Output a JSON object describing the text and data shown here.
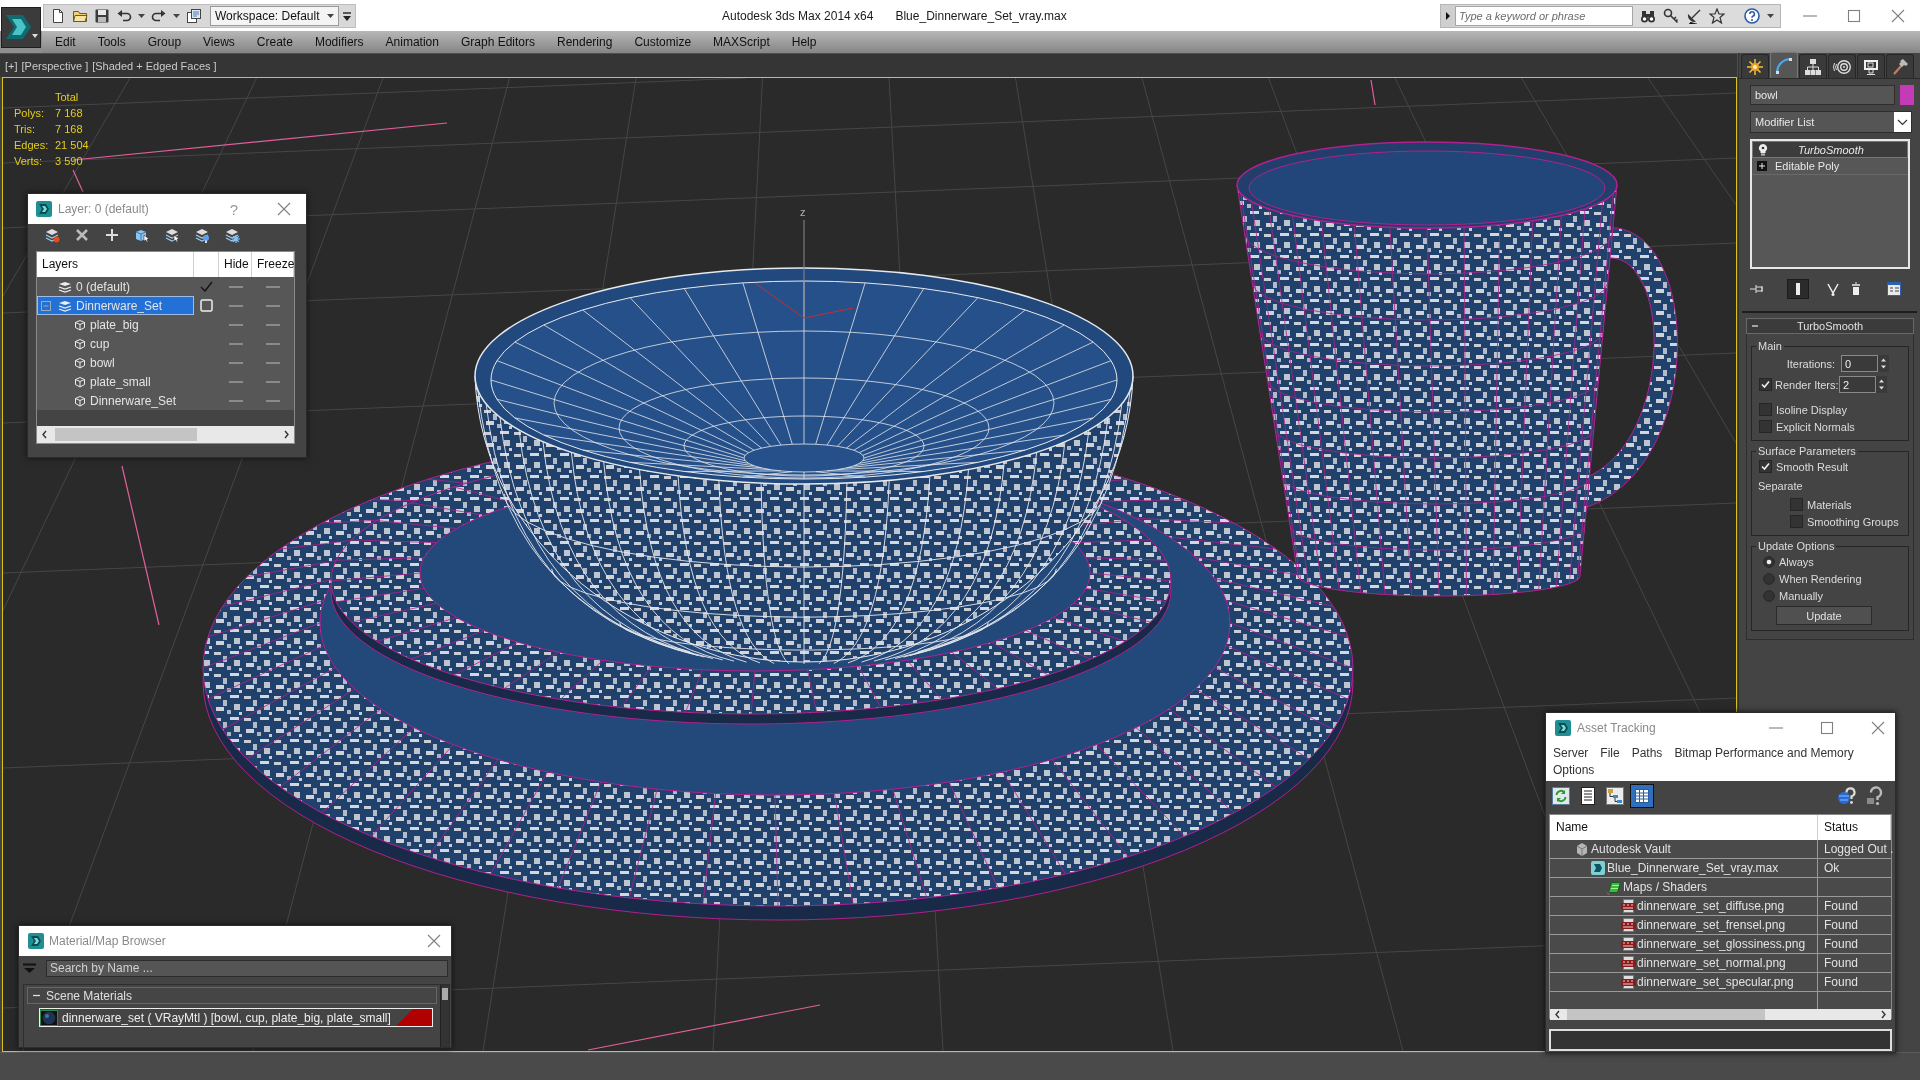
{
  "window": {
    "app_title": "Autodesk 3ds Max 2014 x64",
    "file_name": "Blue_Dinnerware_Set_vray.max",
    "workspace": "Workspace: Default",
    "search": {
      "placeholder": "Type a keyword or phrase"
    }
  },
  "menu": [
    "Edit",
    "Tools",
    "Group",
    "Views",
    "Create",
    "Modifiers",
    "Animation",
    "Graph Editors",
    "Rendering",
    "Customize",
    "MAXScript",
    "Help"
  ],
  "viewport": {
    "labels": [
      "[+]",
      "[Perspective ]",
      "[Shaded + Edged Faces ]"
    ],
    "axis_label": "z",
    "stats": {
      "header": "Total",
      "rows": [
        {
          "label": "Polys:",
          "value": "7 168"
        },
        {
          "label": "Tris:",
          "value": "7 168"
        },
        {
          "label": "Edges:",
          "value": "21 504"
        },
        {
          "label": "Verts:",
          "value": "3 590"
        }
      ]
    }
  },
  "layer_dialog": {
    "title": "Layer: 0 (default)",
    "help": "?",
    "columns": [
      "Layers",
      "Hide",
      "Freeze"
    ],
    "layers": [
      {
        "kind": "layer",
        "name": "0 (default)",
        "selected": false,
        "current": true,
        "hidden": false,
        "frozen": false
      },
      {
        "kind": "layer",
        "name": "Dinnerware_Set",
        "selected": true,
        "current": false,
        "expanded": true,
        "hidden": false,
        "frozen": false,
        "children": [
          {
            "kind": "object",
            "name": "plate_big",
            "selected": false,
            "hidden": false,
            "frozen": false
          },
          {
            "kind": "object",
            "name": "cup",
            "selected": false,
            "hidden": false,
            "frozen": false
          },
          {
            "kind": "object",
            "name": "bowl",
            "selected": false,
            "hidden": false,
            "frozen": false
          },
          {
            "kind": "object",
            "name": "plate_small",
            "selected": false,
            "hidden": false,
            "frozen": false
          },
          {
            "kind": "object",
            "name": "Dinnerware_Set",
            "selected": false,
            "hidden": false,
            "frozen": false
          }
        ]
      }
    ]
  },
  "command_panel": {
    "tabs": [
      {
        "kind": "create",
        "selected": false
      },
      {
        "kind": "modify",
        "selected": true
      },
      {
        "kind": "hierarchy",
        "selected": false
      },
      {
        "kind": "motion",
        "selected": false
      },
      {
        "kind": "display",
        "selected": false
      },
      {
        "kind": "utilities",
        "selected": false
      }
    ],
    "object_name": "bowl",
    "modifier_list": "Modifier List",
    "stack": [
      {
        "kind": "modifier",
        "label": "TurboSmooth",
        "instanced": true,
        "selected": true
      },
      {
        "kind": "base_object",
        "label": "Editable Poly",
        "instanced": false,
        "selected": false
      }
    ],
    "stack_tools": [
      {
        "kind": "pin",
        "on": false
      },
      {
        "kind": "end_result",
        "on": true
      },
      {
        "kind": "make_unique",
        "on": false
      },
      {
        "kind": "remove",
        "on": false
      },
      {
        "kind": "configure",
        "on": false
      }
    ],
    "rollout": {
      "title": "TurboSmooth",
      "expanded": true,
      "groups": [
        {
          "title": "Main",
          "controls": [
            {
              "kind": "spinner",
              "label": "Iterations:",
              "value": "0"
            },
            {
              "kind": "check_spinner",
              "label": "Render Iters:",
              "checked": true,
              "value": "2"
            },
            {
              "kind": "checkbox",
              "label": "Isoline Display",
              "checked": false
            },
            {
              "kind": "checkbox",
              "label": "Explicit Normals",
              "checked": false
            }
          ]
        },
        {
          "title": "Surface Parameters",
          "controls": [
            {
              "kind": "checkbox",
              "label": "Smooth Result",
              "checked": true
            },
            {
              "kind": "label",
              "label": "Separate"
            },
            {
              "kind": "sub_checkbox",
              "label": "Materials",
              "checked": false
            },
            {
              "kind": "sub_checkbox",
              "label": "Smoothing Groups",
              "checked": false
            }
          ]
        },
        {
          "title": "Update Options",
          "controls": [
            {
              "kind": "radio",
              "label": "Always",
              "selected": true
            },
            {
              "kind": "radio",
              "label": "When Rendering",
              "selected": false
            },
            {
              "kind": "radio",
              "label": "Manually",
              "selected": false
            },
            {
              "kind": "button",
              "label": "Update"
            }
          ]
        }
      ]
    }
  },
  "asset_tracking": {
    "title": "Asset Tracking",
    "menu": [
      [
        "Server",
        "File",
        "Paths",
        "Bitmap Performance and Memory"
      ],
      [
        "Options"
      ]
    ],
    "toolbar": [
      {
        "kind": "refresh",
        "selected": false
      },
      {
        "kind": "list",
        "selected": false
      },
      {
        "kind": "tree",
        "selected": false
      },
      {
        "kind": "table",
        "selected": true
      }
    ],
    "columns": [
      "Name",
      "Status"
    ],
    "rows": [
      {
        "kind": "vault",
        "name": "Autodesk Vault",
        "status": "Logged Out .",
        "selected": false,
        "children": [
          {
            "kind": "scene_file",
            "name": "Blue_Dinnerware_Set_vray.max",
            "status": "Ok",
            "selected": false,
            "children": [
              {
                "kind": "folder",
                "name": "Maps / Shaders",
                "selected": false,
                "children": [
                  {
                    "kind": "image",
                    "name": "dinnerware_set_diffuse.png",
                    "status": "Found",
                    "selected": false
                  },
                  {
                    "kind": "image",
                    "name": "dinnerware_set_frensel.png",
                    "status": "Found",
                    "selected": false
                  },
                  {
                    "kind": "image",
                    "name": "dinnerware_set_glossiness.png",
                    "status": "Found",
                    "selected": false
                  },
                  {
                    "kind": "image",
                    "name": "dinnerware_set_normal.png",
                    "status": "Found",
                    "selected": false
                  },
                  {
                    "kind": "image",
                    "name": "dinnerware_set_specular.png",
                    "status": "Found",
                    "selected": false
                  }
                ]
              }
            ]
          }
        ]
      }
    ]
  },
  "material_browser": {
    "title": "Material/Map Browser",
    "search": {
      "placeholder": "Search by Name ..."
    },
    "groups": [
      {
        "title": "Scene Materials",
        "expanded": true,
        "items": [
          {
            "label": "dinnerware_set ( VRayMtl ) [bowl, cup, plate_big, plate_small]",
            "selected": true
          }
        ]
      }
    ]
  }
}
